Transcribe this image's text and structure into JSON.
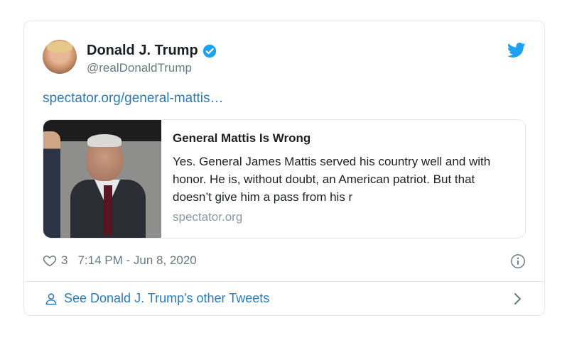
{
  "tweet": {
    "author_name": "Donald J. Trump",
    "author_handle": "@realDonaldTrump",
    "link_text": "spectator.org/general-mattis…",
    "card": {
      "title": "General Mattis Is Wrong",
      "description": "Yes. General James Mattis served his country well and with honor. He is, without doubt, an American patriot. But that doesn’t give him a pass from his r",
      "domain": "spectator.org"
    },
    "like_count": "3",
    "timestamp": "7:14 PM - Jun 8, 2020",
    "footer_link": "See Donald J. Trump's other Tweets"
  },
  "icons": [
    "verified-badge-icon",
    "twitter-bird-icon",
    "heart-icon",
    "info-icon",
    "person-icon",
    "chevron-right-icon"
  ],
  "colors": {
    "link": "#2b7bb9",
    "bird": "#1da1f2",
    "border": "#e1e8ed",
    "muted": "#697882"
  }
}
